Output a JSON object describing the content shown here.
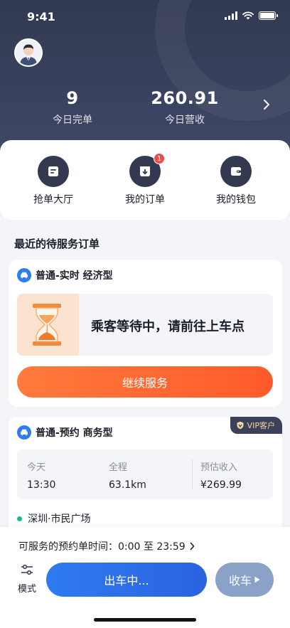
{
  "status_bar": {
    "time": "9:41"
  },
  "header": {
    "stats": [
      {
        "value": "9",
        "label": "今日完单"
      },
      {
        "value": "260.91",
        "label": "今日营收"
      }
    ]
  },
  "quick_actions": [
    {
      "label": "抢单大厅",
      "icon": "order-hall-icon"
    },
    {
      "label": "我的订单",
      "icon": "my-orders-icon",
      "badge": "1"
    },
    {
      "label": "我的钱包",
      "icon": "wallet-icon"
    }
  ],
  "section": {
    "title": "最近的待服务订单"
  },
  "orders": [
    {
      "type_label": "普通-实时 经济型",
      "status_text": "乘客等待中，请前往上车点",
      "action_label": "继续服务"
    },
    {
      "type_label": "普通-预约 商务型",
      "vip_label": "VIP客户",
      "details": [
        {
          "key": "今天",
          "value": "13:30"
        },
        {
          "key": "全程",
          "value": "63.1km"
        },
        {
          "key": "预估收入",
          "value": "¥269.99"
        }
      ],
      "route_start": "深圳·市民广场"
    }
  ],
  "bottom": {
    "booking_time_label": "可服务的预约单时间：0:00 至 23:59",
    "mode_label": "模式",
    "depart_label": "出车中...",
    "offline_label": "收车"
  },
  "colors": {
    "header_bg": "#3a4260",
    "accent_blue": "#2f7bf0",
    "accent_orange": "#ff6a33",
    "badge_red": "#f04b4b"
  }
}
